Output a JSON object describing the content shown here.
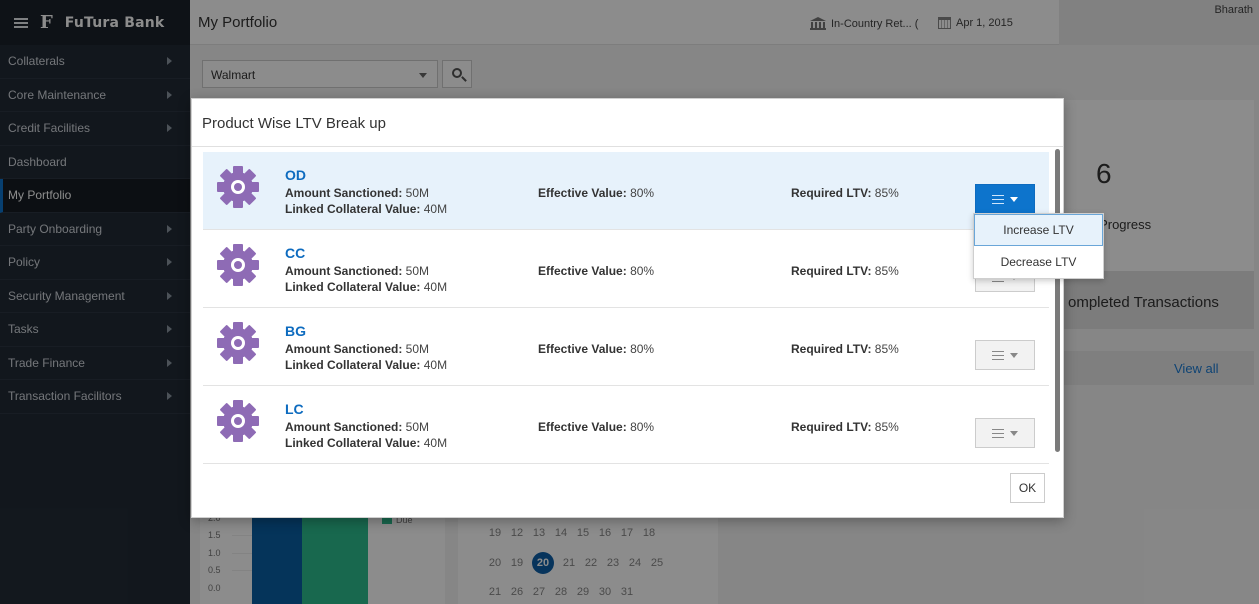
{
  "brand": {
    "name": "FuTura Bank",
    "logo": "F"
  },
  "sidebar": {
    "items": [
      {
        "label": "Collaterals",
        "has_submenu": true
      },
      {
        "label": "Core Maintenance",
        "has_submenu": true
      },
      {
        "label": "Credit Facilities",
        "has_submenu": true
      },
      {
        "label": "Dashboard",
        "has_submenu": false
      },
      {
        "label": "My Portfolio",
        "has_submenu": false,
        "active": true
      },
      {
        "label": "Party Onboarding",
        "has_submenu": true
      },
      {
        "label": "Policy",
        "has_submenu": true
      },
      {
        "label": "Security Management",
        "has_submenu": true
      },
      {
        "label": "Tasks",
        "has_submenu": true
      },
      {
        "label": "Trade Finance",
        "has_submenu": true
      },
      {
        "label": "Transaction Facilitors",
        "has_submenu": true
      }
    ]
  },
  "header": {
    "title": "My Portfolio",
    "entity": "In-Country Ret... (",
    "date": "Apr 1, 2015",
    "user": "Bharath"
  },
  "background": {
    "customer_select": "Walmart",
    "in_progress_count": "6",
    "in_progress_label": "ck In Progress",
    "completed_label": "ompleted Transactions",
    "view_all": "View all",
    "chart_y_labels": [
      "2.0",
      "1.5",
      "1.0",
      "0.5",
      "0.0"
    ],
    "chart_legend": "Due",
    "calendar_rows": [
      [
        "19",
        "12",
        "13",
        "14",
        "15",
        "16",
        "17",
        "18"
      ],
      [
        "20",
        "19",
        "20",
        "21",
        "22",
        "23",
        "24",
        "25"
      ],
      [
        "21",
        "26",
        "27",
        "28",
        "29",
        "30",
        "31"
      ]
    ],
    "calendar_today": "20"
  },
  "modal": {
    "title": "Product Wise LTV Break up",
    "field_labels": {
      "amount_sanctioned": "Amount Sanctioned:",
      "linked_collateral": "Linked Collateral Value:",
      "effective_value": "Effective Value:",
      "required_ltv": "Required LTV:"
    },
    "products": [
      {
        "code": "OD",
        "amount_sanctioned": "50M",
        "linked_collateral": "40M",
        "effective_value": "80%",
        "required_ltv": "85%"
      },
      {
        "code": "CC",
        "amount_sanctioned": "50M",
        "linked_collateral": "40M",
        "effective_value": "80%",
        "required_ltv": "85%"
      },
      {
        "code": "BG",
        "amount_sanctioned": "50M",
        "linked_collateral": "40M",
        "effective_value": "80%",
        "required_ltv": "85%"
      },
      {
        "code": "LC",
        "amount_sanctioned": "50M",
        "linked_collateral": "40M",
        "effective_value": "80%",
        "required_ltv": "85%"
      }
    ],
    "ok_label": "OK"
  },
  "action_menu": {
    "items": [
      "Increase LTV",
      "Decrease LTV"
    ]
  },
  "colors": {
    "accent": "#0d74cc",
    "sidebar_bg": "#222b36",
    "gear": "#8e6bb5",
    "bar_blue": "#0a5fa5",
    "bar_green": "#2dbd8f"
  }
}
